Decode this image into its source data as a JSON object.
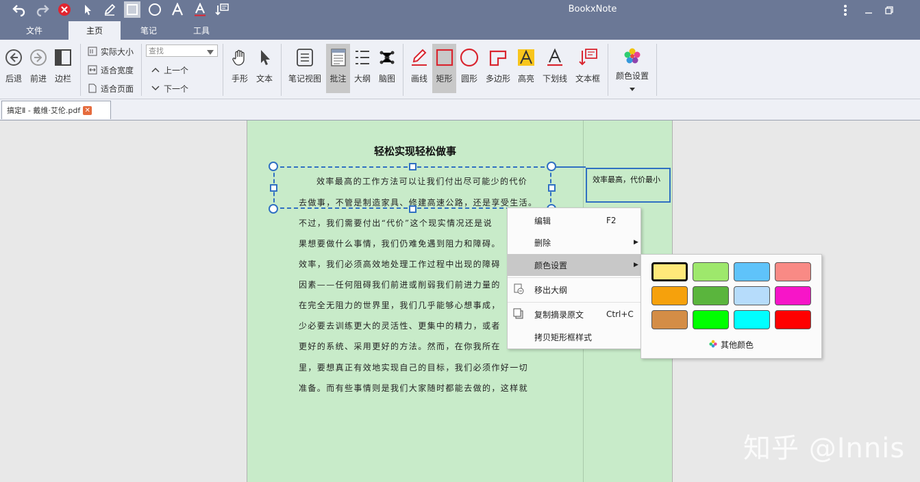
{
  "app": {
    "title": "BookxNote"
  },
  "quick_access": [
    "undo-icon",
    "redo-icon",
    "close-red-icon",
    "pointer-icon",
    "pen-icon",
    "rectangle-icon",
    "circle-icon",
    "text-a-icon",
    "text-underline-icon",
    "textbox-icon"
  ],
  "main_tabs": [
    "文件",
    "主页",
    "笔记",
    "工具"
  ],
  "ribbon": {
    "nav": [
      "后退",
      "前进",
      "边栏"
    ],
    "view": [
      "实际大小",
      "适合宽度",
      "适合页面"
    ],
    "search": {
      "placeholder": "查找",
      "prev": "上一个",
      "next": "下一个"
    },
    "tools": [
      "手形",
      "文本"
    ],
    "notes": [
      "笔记视图",
      "批注",
      "大纲",
      "脑图"
    ],
    "shapes": [
      "画线",
      "矩形",
      "圆形",
      "多边形",
      "高亮",
      "下划线",
      "文本框"
    ],
    "color": "颜色设置"
  },
  "doc_tab": {
    "label": "搞定Ⅱ - 戴维·艾伦.pdf"
  },
  "document": {
    "title": "轻松实现轻松做事",
    "lines": [
      "效率最高的工作方法可以让我们付出尽可能少的代价",
      "去做事，不管是制造家具、修建高速公路，还是享受生活。",
      "不过，我们需要付出“代价”这个现实情况还是说",
      "果想要做什么事情，我们仍难免遇到阻力和障碍。",
      "效率，我们必须高效地处理工作过程中出现的障碍",
      "因素——任何阻碍我们前进或削弱我们前进力量的",
      "在完全无阻力的世界里，我们几乎能够心想事成，",
      "少必要去训练更大的灵活性、更集中的精力，或者",
      "更好的系统、采用更好的方法。然而，在你我所在",
      "里，要想真正有效地实现自己的目标，我们必须作好一切",
      "准备。而有些事情则是我们大家随时都能去做的，这样就"
    ]
  },
  "note_box": {
    "text": "效率最高，代价最小"
  },
  "context_menu": {
    "items": [
      {
        "label": "编辑",
        "shortcut": "F2"
      },
      {
        "label": "删除",
        "submenu": "▶"
      },
      {
        "label": "颜色设置",
        "submenu": "▶"
      },
      {
        "label": "移出大纲"
      },
      {
        "label": "复制摘录原文",
        "shortcut": "Ctrl+C"
      },
      {
        "label": "拷贝矩形框样式"
      }
    ]
  },
  "color_panel": {
    "swatches": [
      "#ffe97a",
      "#9ee86c",
      "#5fc3fa",
      "#f98a85",
      "#f6a10c",
      "#5ab53d",
      "#b6dcfb",
      "#f715c8",
      "#d48d46",
      "#00ff00",
      "#00ffff",
      "#ff0000"
    ],
    "selected_index": 0,
    "more_label": "其他颜色"
  },
  "watermark": "知乎 @Innis",
  "colors": {
    "titlebar": "#6b7896",
    "ribbon": "#eef0f6",
    "page": "#c8ebc9",
    "selection": "#2f6fc2"
  }
}
